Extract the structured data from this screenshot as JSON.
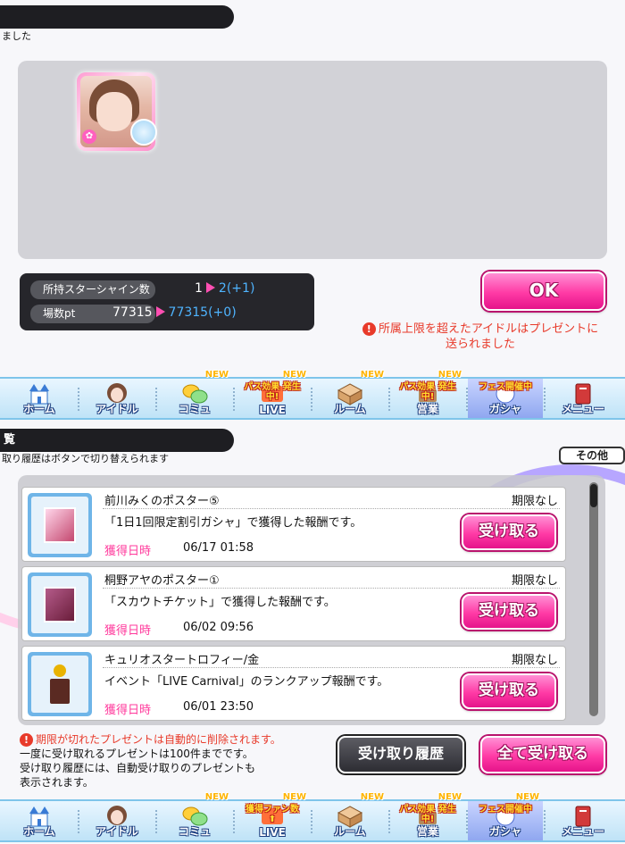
{
  "top_section": {
    "header_fragment": "ました",
    "stats": {
      "star_shine_label": "所持スターシャイン数",
      "star_shine_before": "1",
      "star_shine_after": "2",
      "star_shine_delta": "(+1)",
      "venue_pt_label": "場数pt",
      "venue_pt_before": "77315",
      "venue_pt_after": "77315",
      "venue_pt_delta": "(+0)"
    },
    "ok_label": "OK",
    "warning_line1": "所属上限を超えたアイドルはプレゼントに",
    "warning_line2": "送られました"
  },
  "navbar_top": [
    {
      "label": "ホーム",
      "icon": "castle-icon",
      "new": "",
      "banner": ""
    },
    {
      "label": "アイドル",
      "icon": "idol-face-icon",
      "new": "",
      "banner": ""
    },
    {
      "label": "コミュ",
      "icon": "chat-bubble-icon",
      "new": "NEW",
      "banner": ""
    },
    {
      "label": "LIVE",
      "icon": "live-icon",
      "new": "NEW",
      "banner": "パス効果 発生中!"
    },
    {
      "label": "ルーム",
      "icon": "room-icon",
      "new": "NEW",
      "banner": ""
    },
    {
      "label": "営業",
      "icon": "business-icon",
      "new": "NEW",
      "banner": "パス効果 発生中!"
    },
    {
      "label": "ガシャ",
      "icon": "gacha-icon",
      "new": "",
      "banner": "フェス開催中"
    },
    {
      "label": "メニュー",
      "icon": "menu-book-icon",
      "new": "",
      "banner": ""
    }
  ],
  "present_section": {
    "header_fragment": "覧",
    "subtitle": "取り履歴はボタンで切り替えられます",
    "filter_label": "その他",
    "items": [
      {
        "name": "前川みくのポスター⑤",
        "limit": "期限なし",
        "description": "「1日1回限定割引ガシャ」で獲得した報酬です。",
        "date_label": "獲得日時",
        "date": "06/17 01:58",
        "button": "受け取る",
        "thumb_icon": "poster-icon"
      },
      {
        "name": "桐野アヤのポスター①",
        "limit": "期限なし",
        "description": "「スカウトチケット」で獲得した報酬です。",
        "date_label": "獲得日時",
        "date": "06/02 09:56",
        "button": "受け取る",
        "thumb_icon": "poster-icon"
      },
      {
        "name": "キュリオスタートロフィー/金",
        "limit": "期限なし",
        "description": "イベント「LIVE Carnival」のランクアップ報酬です。",
        "date_label": "獲得日時",
        "date": "06/01 23:50",
        "button": "受け取る",
        "thumb_icon": "trophy-icon"
      }
    ],
    "notes": {
      "line1": "期限が切れたプレゼントは自動的に削除されます。",
      "line2": "一度に受け取れるプレゼントは100件までです。",
      "line3": "受け取り履歴には、自動受け取りのプレゼントも",
      "line4": "表示されます。"
    },
    "history_button": "受け取り履歴",
    "receive_all_button": "全て受け取る"
  },
  "navbar_bottom": [
    {
      "label": "ホーム",
      "icon": "castle-icon",
      "new": "",
      "banner": ""
    },
    {
      "label": "アイドル",
      "icon": "idol-face-icon",
      "new": "",
      "banner": ""
    },
    {
      "label": "コミュ",
      "icon": "chat-bubble-icon",
      "new": "NEW",
      "banner": ""
    },
    {
      "label": "LIVE",
      "icon": "live-icon",
      "new": "NEW",
      "banner": "獲得ファン数⬆"
    },
    {
      "label": "ルーム",
      "icon": "room-icon",
      "new": "NEW",
      "banner": ""
    },
    {
      "label": "営業",
      "icon": "business-icon",
      "new": "NEW",
      "banner": "パス効果 発生中!"
    },
    {
      "label": "ガシャ",
      "icon": "gacha-icon",
      "new": "NEW",
      "banner": "フェス開催中"
    },
    {
      "label": "メニュー",
      "icon": "menu-book-icon",
      "new": "",
      "banner": ""
    }
  ],
  "colors": {
    "accent_pink": "#ff3aa5",
    "nav_blue": "#7fc5ea",
    "warning_red": "#e83a2a"
  }
}
